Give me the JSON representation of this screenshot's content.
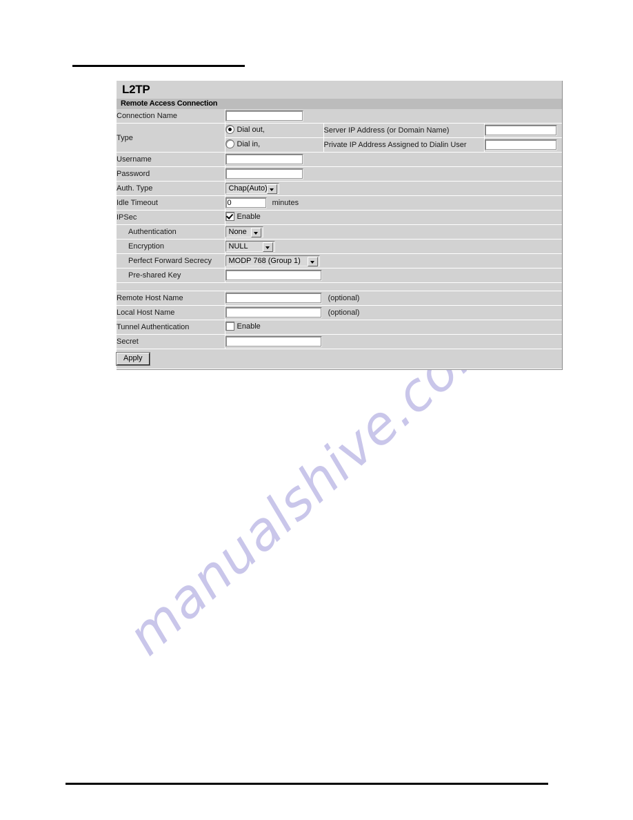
{
  "page": {
    "watermark": "manualshive.com"
  },
  "panel": {
    "title": "L2TP",
    "section": "Remote Access Connection"
  },
  "fields": {
    "connection_name": {
      "label": "Connection Name",
      "value": "",
      "placeholder": ""
    },
    "type": {
      "label": "Type",
      "options": [
        {
          "label": "Dial out,",
          "selected": true,
          "desc": "Server IP Address (or Domain Name)",
          "value": "",
          "placeholder": ""
        },
        {
          "label": "Dial in,",
          "selected": false,
          "desc": "Private IP Address Assigned to Dialin User",
          "value": "",
          "placeholder": ""
        }
      ]
    },
    "username": {
      "label": "Username",
      "value": "",
      "placeholder": ""
    },
    "password": {
      "label": "Password",
      "value": "",
      "placeholder": ""
    },
    "auth_type": {
      "label": "Auth. Type",
      "selected": "Chap(Auto)"
    },
    "idle_timeout": {
      "label": "Idle Timeout",
      "value": "0",
      "unit": "minutes"
    },
    "ipsec": {
      "label": "IPSec",
      "checkbox_label": "Enable",
      "checked": true
    },
    "authentication": {
      "label": "Authentication",
      "selected": "None"
    },
    "encryption": {
      "label": "Encryption",
      "selected": "NULL"
    },
    "pfs": {
      "label": "Perfect Forward Secrecy",
      "selected": "MODP 768 (Group 1)"
    },
    "pre_shared_key": {
      "label": "Pre-shared Key",
      "value": "",
      "placeholder": ""
    },
    "remote_host_name": {
      "label": "Remote Host Name",
      "value": "",
      "placeholder": "",
      "hint": "(optional)"
    },
    "local_host_name": {
      "label": "Local Host Name",
      "value": "",
      "placeholder": "",
      "hint": "(optional)"
    },
    "tunnel_authentication": {
      "label": "Tunnel Authentication",
      "checkbox_label": "Enable",
      "checked": false
    },
    "secret": {
      "label": "Secret",
      "value": "",
      "placeholder": ""
    }
  },
  "actions": {
    "apply_label": "Apply"
  },
  "colors": {
    "label_bg": "#dfdda8",
    "panel_bg": "#d2d2d2",
    "section_bg": "#bcbcbc",
    "watermark": "#c9c6ea"
  }
}
